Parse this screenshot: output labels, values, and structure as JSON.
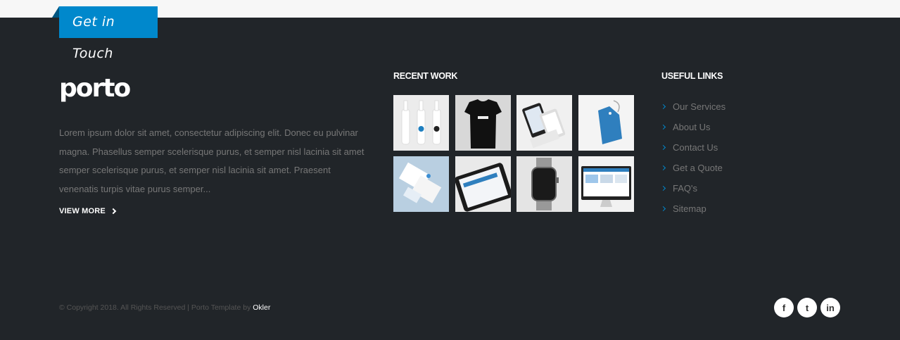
{
  "ribbon": {
    "label": "Get in Touch"
  },
  "about": {
    "logo": "porto",
    "text": "Lorem ipsum dolor sit amet, consectetur adipiscing elit. Donec eu pulvinar magna. Phasellus semper scelerisque purus, et semper nisl lacinia sit amet semper scelerisque purus, et semper nisl lacinia sit amet. Praesent venenatis turpis vitae purus semper...",
    "view_more": "VIEW MORE"
  },
  "recent_work": {
    "title": "RECENT WORK",
    "items": [
      {
        "name": "work-bottles"
      },
      {
        "name": "work-tshirt"
      },
      {
        "name": "work-mobile-devices"
      },
      {
        "name": "work-tag"
      },
      {
        "name": "work-stationery"
      },
      {
        "name": "work-tablet"
      },
      {
        "name": "work-watch"
      },
      {
        "name": "work-monitor"
      }
    ]
  },
  "useful_links": {
    "title": "USEFUL LINKS",
    "items": [
      {
        "label": "Our Services"
      },
      {
        "label": "About Us"
      },
      {
        "label": "Contact Us"
      },
      {
        "label": "Get a Quote"
      },
      {
        "label": "FAQ's"
      },
      {
        "label": "Sitemap"
      }
    ]
  },
  "footer": {
    "copyright": "© Copyright 2018. All Rights Reserved | Porto Template by ",
    "brand": "Okler"
  },
  "social": {
    "facebook": "f",
    "twitter": "t",
    "linkedin": "in"
  },
  "colors": {
    "accent": "#0088cc",
    "background": "#212529"
  }
}
